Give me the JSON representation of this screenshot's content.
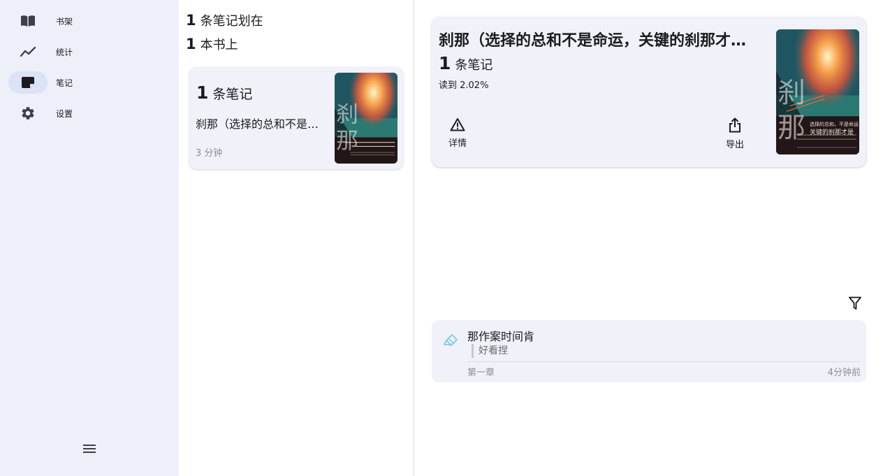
{
  "nav": {
    "items": [
      {
        "label": "书架",
        "icon": "book-open-icon",
        "active": false
      },
      {
        "label": "统计",
        "icon": "trending-line-icon",
        "active": false
      },
      {
        "label": "笔记",
        "icon": "note-icon",
        "active": true
      },
      {
        "label": "设置",
        "icon": "gear-icon",
        "active": false
      }
    ],
    "menu_icon": "hamburger-menu-icon"
  },
  "summary": {
    "notes_count": "1",
    "notes_text": "条笔记划在",
    "books_count": "1",
    "books_text": "本书上"
  },
  "book_list": [
    {
      "note_count": "1",
      "note_label": "条笔记",
      "title": "刹那（选择的总和不是命运，关键的刹那才是）",
      "time": "3 分钟"
    }
  ],
  "detail": {
    "title": "刹那（选择的总和不是命运，关键的刹那才是）",
    "note_count": "1",
    "note_label": "条笔记",
    "progress": "读到 2.02%",
    "actions": [
      {
        "label": "详情",
        "icon": "warning-triangle-icon"
      },
      {
        "label": "导出",
        "icon": "share-export-icon"
      }
    ],
    "cover": {
      "big_chars": "刹那",
      "tagline_1": "选择的总和，不是命运",
      "tagline_2": "关键的刹那才是"
    }
  },
  "filter_icon": "filter-icon",
  "notes": [
    {
      "text": "那作案时间肯",
      "comment": "好看捏",
      "chapter": "第一章",
      "time": "4分钟前",
      "icon": "highlighter-icon"
    }
  ],
  "colors": {
    "rail_bg": "#eef0f9",
    "card_bg": "#f0f1f9",
    "active_pill": "#dbe3f6",
    "highlighter": "#7ec8ef"
  }
}
